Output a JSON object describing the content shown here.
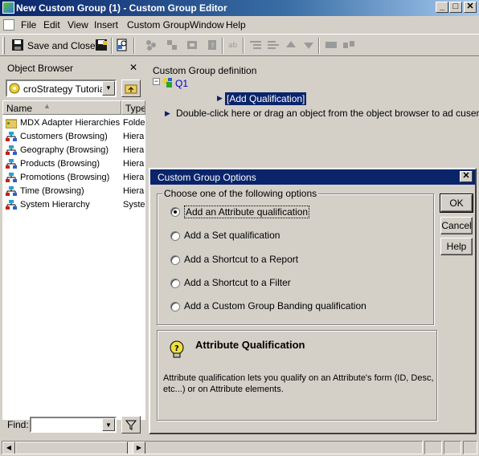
{
  "window": {
    "title": "New Custom Group (1) - Custom Group Editor",
    "min_label": "_",
    "max_label": "□",
    "close_label": "✕"
  },
  "menu": {
    "items": [
      "File",
      "Edit",
      "View",
      "Insert",
      "Custom Group",
      "Window",
      "Help"
    ]
  },
  "toolbar": {
    "save_close_label": "Save and Close"
  },
  "object_browser": {
    "title": "Object Browser",
    "close_label": "✕",
    "project_value": "croStrategy Tutorial",
    "columns": [
      "Name",
      "Type"
    ],
    "rows": [
      {
        "name": "MDX Adapter Hierarchies",
        "type": "Folde",
        "icon": "folder-icon"
      },
      {
        "name": "Customers (Browsing)",
        "type": "Hiera",
        "icon": "hierarchy-icon"
      },
      {
        "name": "Geography (Browsing)",
        "type": "Hiera",
        "icon": "hierarchy-icon"
      },
      {
        "name": "Products (Browsing)",
        "type": "Hiera",
        "icon": "hierarchy-icon"
      },
      {
        "name": "Promotions (Browsing)",
        "type": "Hiera",
        "icon": "hierarchy-icon"
      },
      {
        "name": "Time (Browsing)",
        "type": "Hiera",
        "icon": "hierarchy-icon"
      },
      {
        "name": "System Hierarchy",
        "type": "Syste",
        "icon": "hierarchy-icon"
      }
    ],
    "find_label": "Find:",
    "find_value": ""
  },
  "definition": {
    "title": "Custom Group definition",
    "root_label": "Q1",
    "add_qualification": "[Add Qualification]",
    "hint": "Double-click here or drag an object from the object browser to ad cusent."
  },
  "dialog": {
    "title": "Custom Group Options",
    "close_label": "✕",
    "group_label": "Choose one of the following options",
    "options": [
      {
        "label": "Add an Attribute qualification",
        "checked": true
      },
      {
        "label": "Add a Set qualification",
        "checked": false
      },
      {
        "label": "Add a Shortcut to a Report",
        "checked": false
      },
      {
        "label": "Add a Shortcut to a Filter",
        "checked": false
      },
      {
        "label": "Add a Custom Group Banding qualification",
        "checked": false
      }
    ],
    "ok_label": "OK",
    "cancel_label": "Cancel",
    "help_label": "Help",
    "info_title": "Attribute Qualification",
    "info_text_line1": "Attribute qualification lets you qualify on an Attribute's form (ID, Desc,",
    "info_text_line2": "etc...) or on Attribute elements."
  },
  "colors": {
    "title_active": "#0a246a",
    "face": "#d4d0c8",
    "link_blue": "#0000c0"
  }
}
